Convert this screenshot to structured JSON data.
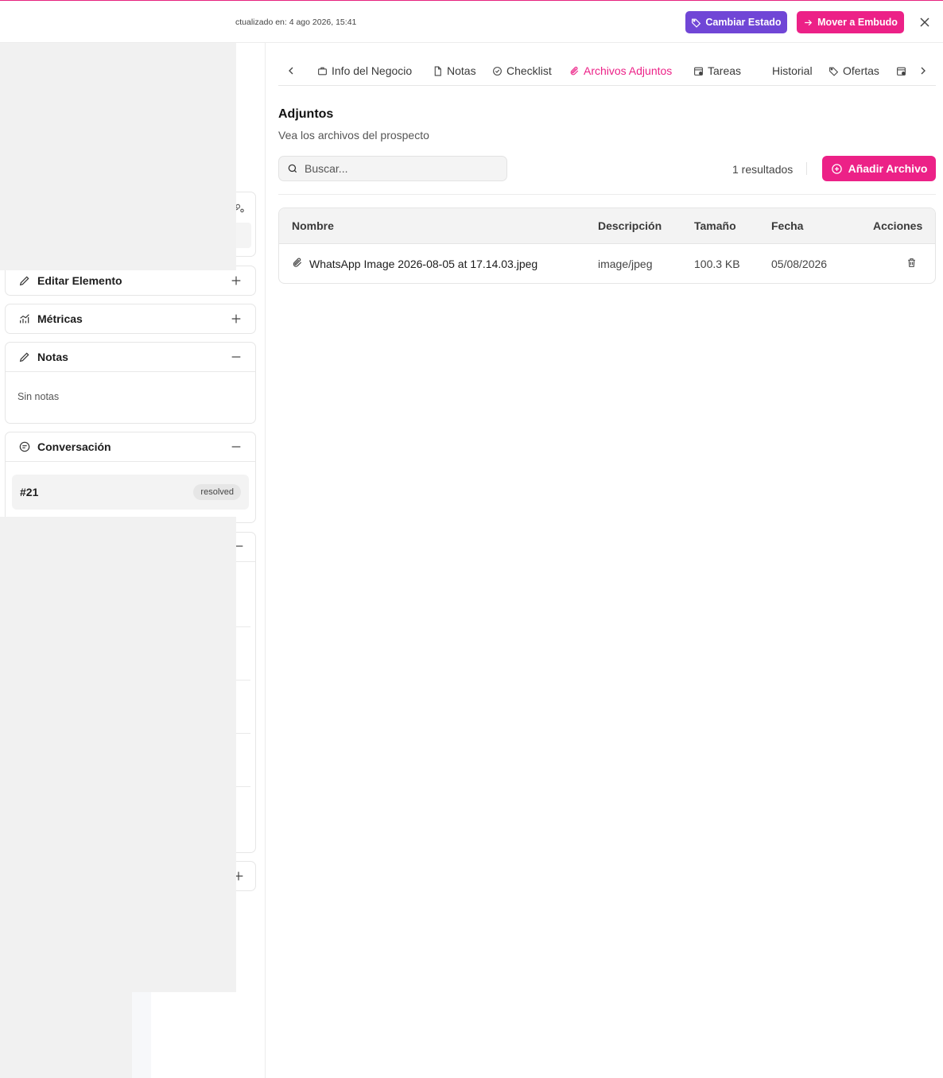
{
  "header": {
    "updated_text": "ctualizado en: 4 ago 2026, 15:41",
    "change_state_label": "Cambiar Estado",
    "move_funnel_label": "Mover a Embudo",
    "accent_purple": "#7046d6",
    "accent_pink": "#ec2187"
  },
  "sidebar": {
    "edit_label": "Editar Elemento",
    "metrics_label": "Métricas",
    "notes_label": "Notas",
    "notes_empty": "Sin notas",
    "conversation_label": "Conversación",
    "conversation_id": "#21",
    "conversation_status": "resolved"
  },
  "tabs": [
    {
      "label": "Info del Negocio",
      "icon": "briefcase-icon"
    },
    {
      "label": "Notas",
      "icon": "file-icon"
    },
    {
      "label": "Checklist",
      "icon": "check-circle-icon"
    },
    {
      "label": "Archivos Adjuntos",
      "icon": "paperclip-icon",
      "active": true
    },
    {
      "label": "Tareas",
      "icon": "calendar-icon"
    },
    {
      "label": "Historial",
      "icon": ""
    },
    {
      "label": "Ofertas",
      "icon": "tag-icon"
    }
  ],
  "attachments": {
    "title": "Adjuntos",
    "subtitle": "Vea los archivos del prospecto",
    "search_placeholder": "Buscar...",
    "results_text": "1 resultados",
    "add_label": "Añadir Archivo",
    "columns": [
      "Nombre",
      "Descripción",
      "Tamaño",
      "Fecha",
      "Acciones"
    ],
    "rows": [
      {
        "name": "WhatsApp Image 2026-08-05 at 17.14.03.jpeg",
        "description": "image/jpeg",
        "size": "100.3 KB",
        "date": "05/08/2026"
      }
    ]
  }
}
